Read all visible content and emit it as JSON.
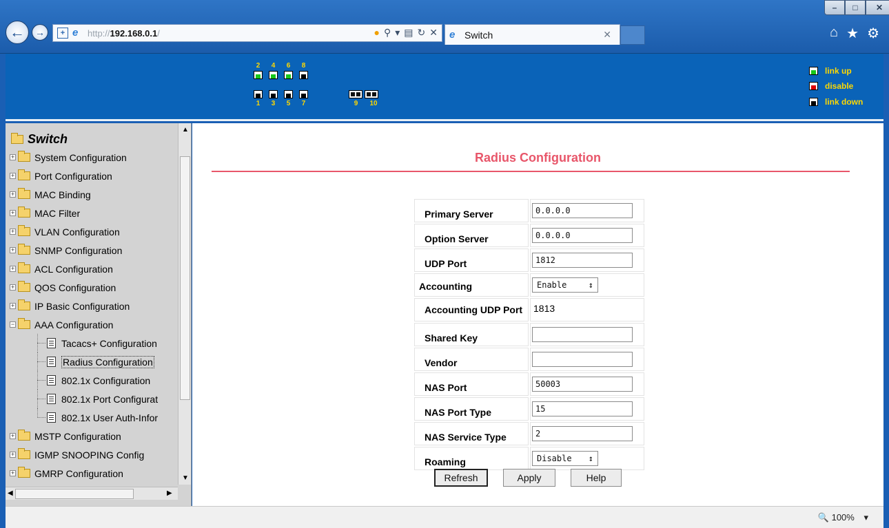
{
  "browser": {
    "url_protocol": "http://",
    "url_host": "192.168.0.1",
    "url_slash": "/",
    "tab_title": "Switch",
    "window_controls": [
      "–",
      "□",
      "✕"
    ],
    "tool_icons": [
      "home-icon",
      "favorites-star-icon",
      "settings-gear-icon"
    ]
  },
  "device_panel": {
    "top_ports": [
      {
        "num": "2",
        "state": "up"
      },
      {
        "num": "4",
        "state": "up"
      },
      {
        "num": "6",
        "state": "up"
      },
      {
        "num": "8",
        "state": "down"
      }
    ],
    "bottom_ports": [
      {
        "num": "1",
        "state": "down"
      },
      {
        "num": "3",
        "state": "down"
      },
      {
        "num": "5",
        "state": "down"
      },
      {
        "num": "7",
        "state": "down"
      }
    ],
    "sfp_ports": [
      {
        "num": "9"
      },
      {
        "num": "10"
      }
    ],
    "legend": {
      "link_up": "link up",
      "disable": "disable",
      "link_down": "link down"
    },
    "colors": {
      "up": "#19c81a",
      "disable": "#e00000",
      "down": "#000000",
      "label": "#ffd800",
      "background": "#0a63b8"
    }
  },
  "sidebar": {
    "root": "Switch",
    "items": [
      {
        "label": "System Configuration"
      },
      {
        "label": "Port Configuration"
      },
      {
        "label": "MAC Binding"
      },
      {
        "label": "MAC Filter"
      },
      {
        "label": "VLAN Configuration"
      },
      {
        "label": "SNMP Configuration"
      },
      {
        "label": "ACL Configuration"
      },
      {
        "label": "QOS Configuration"
      },
      {
        "label": "IP Basic Configuration"
      },
      {
        "label": "AAA Configuration"
      }
    ],
    "aaa_children": [
      {
        "label": "Tacacs+ Configuration"
      },
      {
        "label": "Radius Configuration"
      },
      {
        "label": "802.1x Configuration"
      },
      {
        "label": "802.1x Port Configurat"
      },
      {
        "label": "802.1x User Auth-Infor"
      }
    ],
    "items_after": [
      {
        "label": "MSTP Configuration"
      },
      {
        "label": "IGMP SNOOPING Config"
      },
      {
        "label": "GMRP Configuration"
      }
    ],
    "selected": "Radius Configuration"
  },
  "main": {
    "title": "Radius Configuration",
    "title_color": "#e8566a",
    "fields": {
      "primary_server": {
        "label": "Primary Server",
        "value": "0.0.0.0"
      },
      "option_server": {
        "label": "Option Server",
        "value": "0.0.0.0"
      },
      "udp_port": {
        "label": "UDP Port",
        "value": "1812"
      },
      "accounting": {
        "label": "Accounting",
        "value": "Enable"
      },
      "accounting_udp_port": {
        "label": "Accounting UDP Port",
        "value": "1813"
      },
      "shared_key": {
        "label": "Shared Key",
        "value": ""
      },
      "vendor": {
        "label": "Vendor",
        "value": ""
      },
      "nas_port": {
        "label": "NAS Port",
        "value": "50003"
      },
      "nas_port_type": {
        "label": "NAS Port Type",
        "value": "15"
      },
      "nas_service_type": {
        "label": "NAS Service Type",
        "value": "2"
      },
      "roaming": {
        "label": "Roaming",
        "value": "Disable"
      }
    },
    "buttons": {
      "refresh": "Refresh",
      "apply": "Apply",
      "help": "Help"
    }
  },
  "status_bar": {
    "zoom": "100%"
  }
}
